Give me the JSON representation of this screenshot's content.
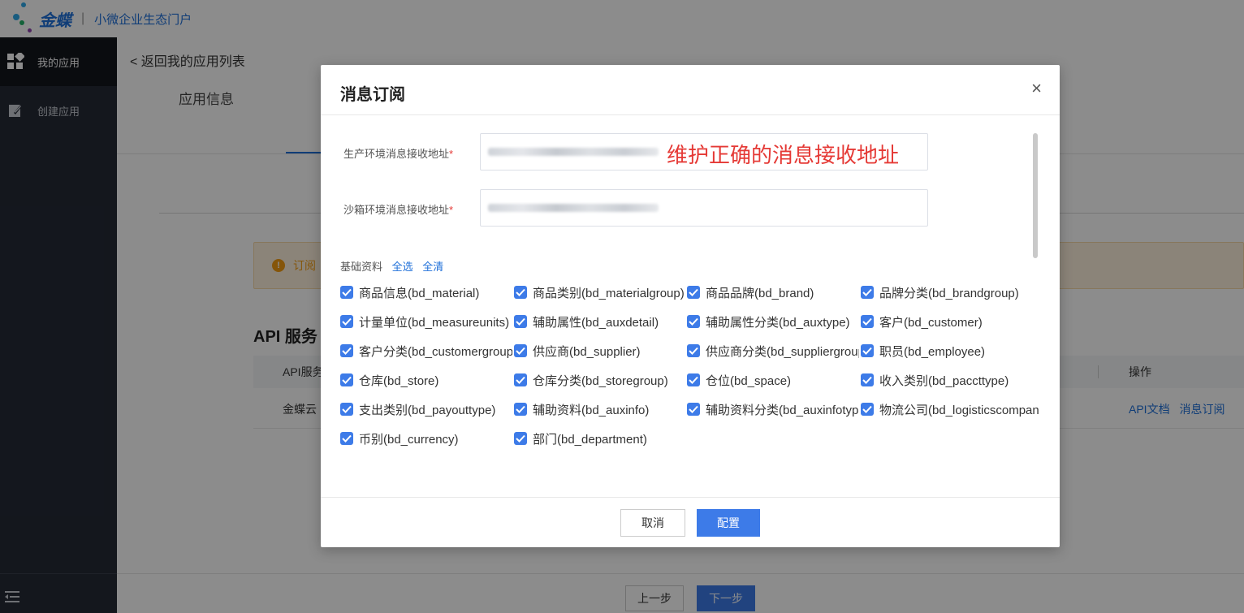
{
  "header": {
    "brand": "金蝶",
    "separator": "|",
    "subtitle": "小微企业生态门户"
  },
  "sidebar": {
    "items": [
      {
        "label": "我的应用",
        "icon": "grid-icon",
        "active": true
      },
      {
        "label": "创建应用",
        "icon": "edit-icon",
        "active": false
      }
    ],
    "collapse_icon": "menu-collapse-icon"
  },
  "main": {
    "back_link": "< 返回我的应用列表",
    "tab_app_info": "应用信息",
    "notice_text": "订阅",
    "section_title": "API 服务",
    "table": {
      "col_api": "API服务",
      "col_ops": "操作",
      "row_name": "金蝶云",
      "op_doc": "API文档",
      "op_subscribe": "消息订阅"
    },
    "btn_prev": "上一步",
    "btn_next": "下一步"
  },
  "modal": {
    "title": "消息订阅",
    "close": "×",
    "prod_label": "生产环境消息接收地址",
    "sandbox_label": "沙箱环境消息接收地址",
    "required_mark": "*",
    "annotation": "维护正确的消息接收地址",
    "group_title": "基础资料",
    "select_all": "全选",
    "clear_all": "全清",
    "checkboxes": [
      {
        "label": "商品信息(bd_material)",
        "checked": true
      },
      {
        "label": "商品类别(bd_materialgroup)",
        "checked": true
      },
      {
        "label": "商品品牌(bd_brand)",
        "checked": true
      },
      {
        "label": "品牌分类(bd_brandgroup)",
        "checked": true
      },
      {
        "label": "计量单位(bd_measureunits)",
        "checked": true
      },
      {
        "label": "辅助属性(bd_auxdetail)",
        "checked": true
      },
      {
        "label": "辅助属性分类(bd_auxtype)",
        "checked": true
      },
      {
        "label": "客户(bd_customer)",
        "checked": true
      },
      {
        "label": "客户分类(bd_customergroup)",
        "checked": true
      },
      {
        "label": "供应商(bd_supplier)",
        "checked": true
      },
      {
        "label": "供应商分类(bd_suppliergroup)",
        "checked": true
      },
      {
        "label": "职员(bd_employee)",
        "checked": true
      },
      {
        "label": "仓库(bd_store)",
        "checked": true
      },
      {
        "label": "仓库分类(bd_storegroup)",
        "checked": true
      },
      {
        "label": "仓位(bd_space)",
        "checked": true
      },
      {
        "label": "收入类别(bd_paccttype)",
        "checked": true
      },
      {
        "label": "支出类别(bd_payouttype)",
        "checked": true
      },
      {
        "label": "辅助资料(bd_auxinfo)",
        "checked": true
      },
      {
        "label": "辅助资料分类(bd_auxinfotype)",
        "checked": true
      },
      {
        "label": "物流公司(bd_logisticscompany)",
        "checked": true
      },
      {
        "label": "币别(bd_currency)",
        "checked": true
      },
      {
        "label": "部门(bd_department)",
        "checked": true
      }
    ],
    "btn_cancel": "取消",
    "btn_confirm": "配置"
  },
  "colors": {
    "accent": "#3d7be8",
    "brand_blue": "#1e6fd9",
    "annotation_red": "#e53935",
    "sidebar_bg": "#252a36",
    "warning": "#f39c12"
  }
}
